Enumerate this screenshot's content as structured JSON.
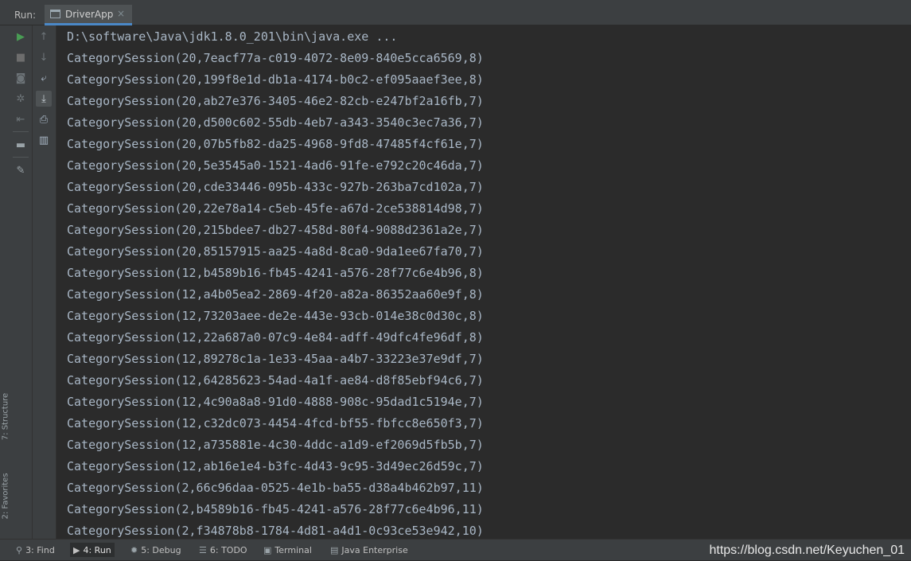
{
  "run_panel": {
    "label": "Run:",
    "tab_title": "DriverApp",
    "tab_close": "×"
  },
  "side_labels": {
    "structure": "7: Structure",
    "favorites": "2: Favorites"
  },
  "toolbar_icons": [
    "run-icon",
    "stop-icon",
    "camera-icon",
    "settings-icon",
    "exit-icon",
    "layout-icon",
    "pin-icon",
    "up-arrow-icon",
    "down-arrow-icon",
    "soft-wrap-icon",
    "scroll-to-end-icon",
    "print-icon",
    "trash-icon"
  ],
  "console": {
    "command": "D:\\software\\Java\\jdk1.8.0_201\\bin\\java.exe ...",
    "lines": [
      "CategorySession(20,7eacf77a-c019-4072-8e09-840e5cca6569,8)",
      "CategorySession(20,199f8e1d-db1a-4174-b0c2-ef095aaef3ee,8)",
      "CategorySession(20,ab27e376-3405-46e2-82cb-e247bf2a16fb,7)",
      "CategorySession(20,d500c602-55db-4eb7-a343-3540c3ec7a36,7)",
      "CategorySession(20,07b5fb82-da25-4968-9fd8-47485f4cf61e,7)",
      "CategorySession(20,5e3545a0-1521-4ad6-91fe-e792c20c46da,7)",
      "CategorySession(20,cde33446-095b-433c-927b-263ba7cd102a,7)",
      "CategorySession(20,22e78a14-c5eb-45fe-a67d-2ce538814d98,7)",
      "CategorySession(20,215bdee7-db27-458d-80f4-9088d2361a2e,7)",
      "CategorySession(20,85157915-aa25-4a8d-8ca0-9da1ee67fa70,7)",
      "CategorySession(12,b4589b16-fb45-4241-a576-28f77c6e4b96,8)",
      "CategorySession(12,a4b05ea2-2869-4f20-a82a-86352aa60e9f,8)",
      "CategorySession(12,73203aee-de2e-443e-93cb-014e38c0d30c,8)",
      "CategorySession(12,22a687a0-07c9-4e84-adff-49dfc4fe96df,8)",
      "CategorySession(12,89278c1a-1e33-45aa-a4b7-33223e37e9df,7)",
      "CategorySession(12,64285623-54ad-4a1f-ae84-d8f85ebf94c6,7)",
      "CategorySession(12,4c90a8a8-91d0-4888-908c-95dad1c5194e,7)",
      "CategorySession(12,c32dc073-4454-4fcd-bf55-fbfcc8e650f3,7)",
      "CategorySession(12,a735881e-4c30-4ddc-a1d9-ef2069d5fb5b,7)",
      "CategorySession(12,ab16e1e4-b3fc-4d43-9c95-3d49ec26d59c,7)",
      "CategorySession(2,66c96daa-0525-4e1b-ba55-d38a4b462b97,11)",
      "CategorySession(2,b4589b16-fb45-4241-a576-28f77c6e4b96,11)",
      "CategorySession(2,f34878b8-1784-4d81-a4d1-0c93ce53e942,10)"
    ]
  },
  "bottom_tools": [
    {
      "label": "3: Find",
      "icon": "search-icon"
    },
    {
      "label": "4: Run",
      "icon": "run-icon"
    },
    {
      "label": "5: Debug",
      "icon": "bug-icon"
    },
    {
      "label": "6: TODO",
      "icon": "list-icon"
    },
    {
      "label": "Terminal",
      "icon": "terminal-icon"
    },
    {
      "label": "Java Enterprise",
      "icon": "enterprise-icon"
    }
  ],
  "watermark": "https://blog.csdn.net/Keyuchen_01",
  "colors": {
    "background": "#2b2b2b",
    "panel": "#3c3f41",
    "text": "#a9b7c6",
    "run_green": "#499c54",
    "tab_accent": "#4a88c7"
  }
}
